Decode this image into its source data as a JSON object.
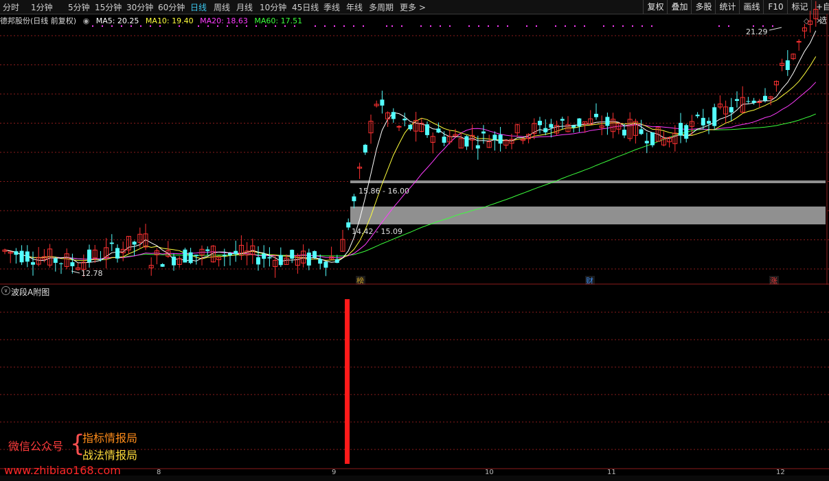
{
  "toolbar": {
    "periods": [
      {
        "label": "分时",
        "active": false
      },
      {
        "label": "1分钟",
        "active": false
      },
      {
        "label": "5分钟",
        "active": false
      },
      {
        "label": "15分钟",
        "active": false
      },
      {
        "label": "30分钟",
        "active": false
      },
      {
        "label": "60分钟",
        "active": false
      },
      {
        "label": "日线",
        "active": true
      },
      {
        "label": "周线",
        "active": false
      },
      {
        "label": "月线",
        "active": false
      },
      {
        "label": "10分钟",
        "active": false
      },
      {
        "label": "45日线",
        "active": false
      },
      {
        "label": "季线",
        "active": false
      },
      {
        "label": "年线",
        "active": false
      },
      {
        "label": "多周期",
        "active": false
      },
      {
        "label": "更多 >",
        "active": false
      }
    ],
    "right_buttons": [
      "复权",
      "叠加",
      "多股",
      "统计",
      "画线",
      "F10",
      "标记",
      "+自选"
    ]
  },
  "legend": {
    "stock": "德邦股份(日线 前复权)",
    "ma5": "MA5: 20.25",
    "ma10": "MA10: 19.40",
    "ma20": "MA20: 18.63",
    "ma60": "MA60: 17.51"
  },
  "colors": {
    "up": "#ff3232",
    "down": "#54ffff",
    "ma5": "#ffffff",
    "ma10": "#ffff3c",
    "ma20": "#ff3cff",
    "ma60": "#3cff3c",
    "grid": "#8b1c1c",
    "zone": "#909090",
    "signal": "#ff1a1a"
  },
  "price_labels": {
    "high": "21.29",
    "low": "12.78",
    "zone_upper": "15.86 - 16.00",
    "zone_lower": "14.42 - 15.09"
  },
  "event_markers": [
    {
      "label": "榜",
      "color": "#c8a028"
    },
    {
      "label": "财",
      "color": "#3c8cf0"
    },
    {
      "label": "涨",
      "color": "#e63c3c"
    }
  ],
  "sub_chart": {
    "title": "波段A附图"
  },
  "date_axis": [
    "8",
    "9",
    "10",
    "11",
    "12"
  ],
  "promo": {
    "wechat": "微信公众号",
    "line1": "指标情报局",
    "line2": "战法情报局",
    "url": "www.zhibiao168.com"
  }
}
